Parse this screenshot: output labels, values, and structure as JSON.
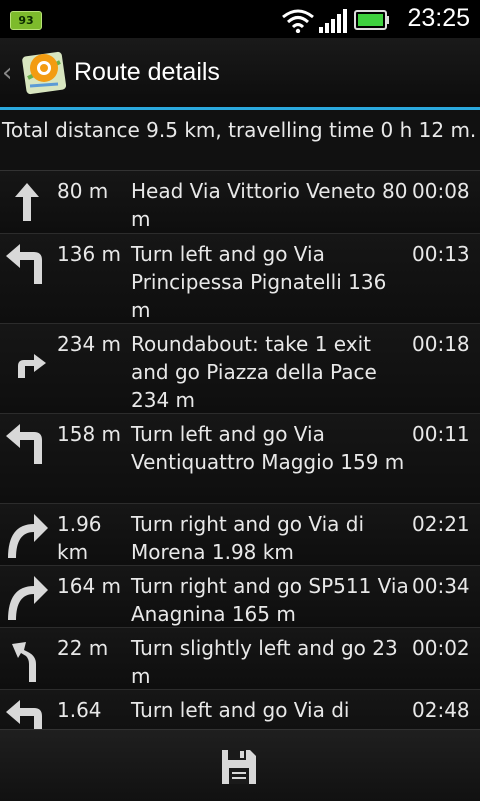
{
  "status_bar": {
    "battery_percent": "93",
    "time": "23:25",
    "icons": [
      "wifi-icon",
      "signal-icon",
      "battery-icon"
    ],
    "accent_color": "#2aa8dd"
  },
  "header": {
    "title": "Route details",
    "app_icon": "map-pin-app-icon"
  },
  "summary": {
    "text": "Total distance 9.5 km, travelling time 0 h 12 m."
  },
  "route": [
    {
      "icon": "arrow-straight-icon",
      "distance": "80 m",
      "instruction": "Head Via Vittorio Veneto 80 m",
      "time": "00:08"
    },
    {
      "icon": "turn-left-icon",
      "distance": "136 m",
      "instruction": "Turn left and go Via Principessa Pignatelli 136 m",
      "time": "00:13"
    },
    {
      "icon": "roundabout-icon",
      "distance": "234 m",
      "instruction": "Roundabout: take 1 exit and go Piazza della Pace 234 m",
      "time": "00:18"
    },
    {
      "icon": "turn-left-icon",
      "distance": "158 m",
      "instruction": "Turn left and go Via Ventiquattro Maggio 159 m",
      "time": "00:11"
    },
    {
      "icon": "turn-right-icon",
      "distance": "1.96 km",
      "instruction": "Turn right and go Via di Morena 1.98 km",
      "time": "02:21"
    },
    {
      "icon": "turn-right-icon",
      "distance": "164 m",
      "instruction": "Turn right and go SP511 Via Anagnina 165 m",
      "time": "00:34"
    },
    {
      "icon": "slight-left-icon",
      "distance": "22 m",
      "instruction": "Turn slightly left and go 23 m",
      "time": "00:02"
    },
    {
      "icon": "turn-left-icon",
      "distance": "1.64",
      "instruction": "Turn left and go Via di",
      "time": "02:48"
    }
  ],
  "bottom_bar": {
    "save_icon": "save-icon"
  }
}
